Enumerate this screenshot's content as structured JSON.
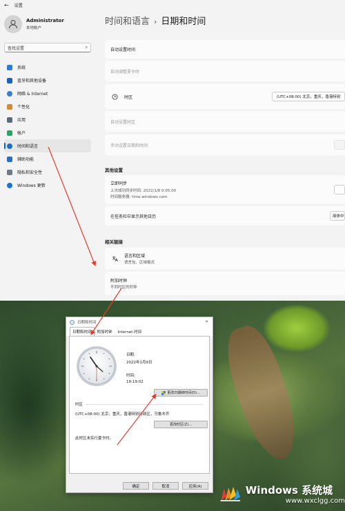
{
  "window": {
    "title": "设置"
  },
  "profile": {
    "name": "Administrator",
    "account_type": "本地帐户"
  },
  "search": {
    "placeholder": "查找设置"
  },
  "sidebar": {
    "items": [
      {
        "label": "系统",
        "icon": "monitor-icon",
        "color": "#2b7cd3"
      },
      {
        "label": "蓝牙和其他设备",
        "icon": "bluetooth-icon",
        "color": "#1f5fbf"
      },
      {
        "label": "网络 & Internet",
        "icon": "wifi-icon",
        "color": "#3a7fd0"
      },
      {
        "label": "个性化",
        "icon": "brush-icon",
        "color": "#d28a35"
      },
      {
        "label": "应用",
        "icon": "apps-icon",
        "color": "#5b6a7a"
      },
      {
        "label": "帐户",
        "icon": "person-icon",
        "color": "#2fa36b"
      },
      {
        "label": "时间和语言",
        "icon": "globe-clock-icon",
        "color": "#1e6fc7",
        "active": true
      },
      {
        "label": "辅助功能",
        "icon": "accessibility-icon",
        "color": "#2c6cc2"
      },
      {
        "label": "隐私和安全性",
        "icon": "shield-icon",
        "color": "#6f7a85"
      },
      {
        "label": "Windows 更新",
        "icon": "update-icon",
        "color": "#1e74d4"
      }
    ]
  },
  "breadcrumb": {
    "parent": "时间和语言",
    "separator": "›",
    "current": "日期和时间"
  },
  "settings_rows": {
    "auto_time": "自动设置时间",
    "auto_dst": "自动调整夏令时",
    "timezone_label": "时区",
    "timezone_value": "(UTC+08:00) 北京，重庆，香港特别",
    "auto_timezone": "自动设置时区",
    "manual_set": "手动设置日期和时间",
    "other_settings_title": "其他设置",
    "sync_title": "立即同步",
    "sync_last": "上次成功同步时间: 2022/1/8 0:05:00",
    "sync_server": "时间服务器: time.windows.com",
    "taskbar_calendar": "在任务栏中显示其他日历",
    "taskbar_calendar_value": "简体中",
    "related_links_title": "相关链接",
    "language_region": "语言和区域",
    "language_region_sub": "语言包、区域格式",
    "additional_clocks": "附加时钟",
    "additional_clocks_sub": "不同时区的时钟"
  },
  "dialog": {
    "title": "日期和时间",
    "tabs": [
      "日期和时间",
      "附加时钟",
      "Internet 时间"
    ],
    "date_label": "日期:",
    "date_value": "2022年1月9日",
    "time_label": "时间:",
    "time_value": "19:19:02",
    "change_datetime_button": "更改日期和时间(D)...",
    "timezone_group": "时区",
    "timezone_value": "(UTC+08:00) 北京，重庆，香港特别行政区，乌鲁木齐",
    "change_timezone_button": "更改时区(Z)...",
    "dst_note": "此时区未实行夏令时。",
    "ok": "确定",
    "cancel": "取消",
    "apply": "应用(A)"
  },
  "watermark": {
    "brand": "Windows 系统城",
    "url": "www.wxclgg.com"
  },
  "colors": {
    "accent": "#0067c0",
    "annotation_arrow": "#e53a2a"
  }
}
